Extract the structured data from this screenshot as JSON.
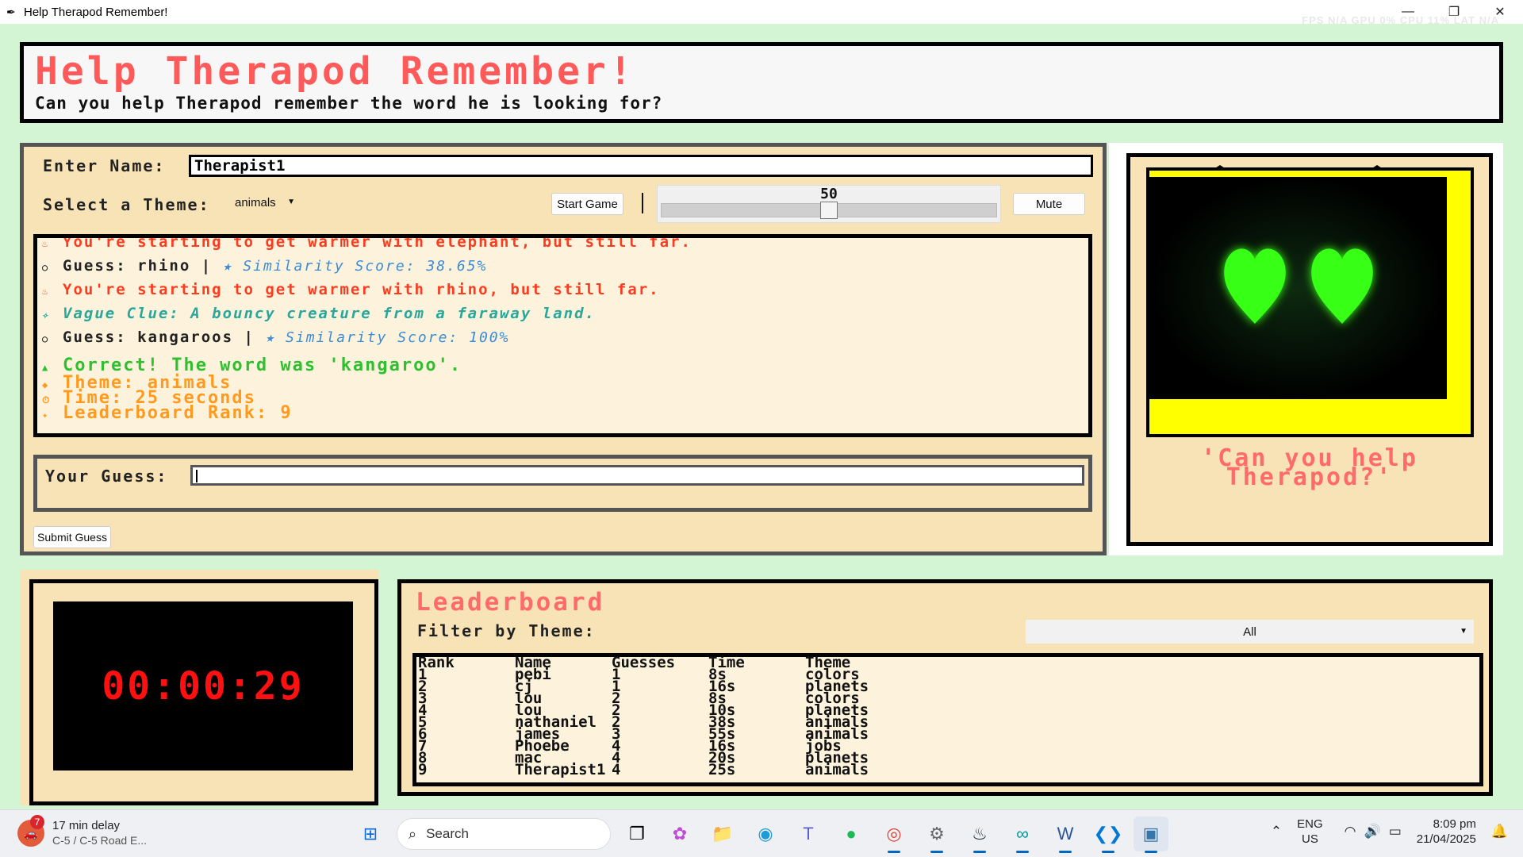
{
  "window": {
    "title": "Help Therapod Remember!",
    "overlay_stats": "FPS N/A   GPU 0%   CPU 11%   LAT N/A",
    "controls": [
      "—",
      "❐",
      "✕"
    ]
  },
  "header": {
    "title": "Help Therapod Remember!",
    "subtitle": "Can you help Therapod remember the word he is looking for?"
  },
  "form": {
    "name_label": "Enter Name:",
    "name_value": "Therapist1",
    "theme_label": "Select a Theme:",
    "theme_value": "animals",
    "start_button": "Start Game",
    "volume_value": "50",
    "volume_level": 0.5,
    "mute_button": "Mute"
  },
  "log": {
    "lines": [
      {
        "icon": "♨",
        "text": "You're starting to get warmer with elephant, but still far."
      },
      {
        "icon": "○",
        "guess_prefix": "Guess: rhino |",
        "score": "Similarity Score: 38.65%"
      },
      {
        "icon": "♨",
        "text": "You're starting to get warmer with rhino, but still far."
      },
      {
        "icon": "✧",
        "text": "Vague Clue: A bouncy creature from a faraway land."
      },
      {
        "icon": "○",
        "guess_prefix": "Guess: kangaroos |",
        "score": "Similarity Score: 100%"
      }
    ],
    "result": {
      "correct": "Correct! The word was 'kangaroo'.",
      "theme": "Theme: animals",
      "time": "Time: 25 seconds",
      "rank": "Leaderboard Rank: 9"
    }
  },
  "guess": {
    "label": "Your Guess:",
    "value": "",
    "submit_button": "Submit Guess"
  },
  "character": {
    "speech": "'Can you help Therapod?'"
  },
  "timer": {
    "value": "00:00:29"
  },
  "leaderboard": {
    "title": "Leaderboard",
    "filter_label": "Filter by Theme:",
    "filter_value": "All",
    "columns": [
      "Rank",
      "Name",
      "Guesses",
      "Time",
      "Theme"
    ],
    "rows": [
      [
        "1",
        "pebi",
        "1",
        "8s",
        "colors"
      ],
      [
        "2",
        "cj",
        "1",
        "16s",
        "planets"
      ],
      [
        "3",
        "lou",
        "2",
        "8s",
        "colors"
      ],
      [
        "4",
        "lou",
        "2",
        "10s",
        "planets"
      ],
      [
        "5",
        "nathaniel",
        "2",
        "38s",
        "animals"
      ],
      [
        "6",
        "james",
        "3",
        "55s",
        "animals"
      ],
      [
        "7",
        "Phoebe",
        "4",
        "16s",
        "jobs"
      ],
      [
        "8",
        "mac",
        "4",
        "20s",
        "planets"
      ],
      [
        "9",
        "Therapist1",
        "4",
        "25s",
        "animals"
      ]
    ]
  },
  "taskbar": {
    "weather_badge": "7",
    "weather_title": "17 min delay",
    "weather_sub": "C-5 / C-5 Road E...",
    "search_placeholder": "Search",
    "lang_top": "ENG",
    "lang_bottom": "US",
    "time": "8:09 pm",
    "date": "21/04/2025"
  },
  "colors": {
    "panel_bg": "#f7e3b5",
    "title_red": "#ff5a5a",
    "screen_yellow": "#ffff00",
    "heart_green": "#39ff14",
    "timer_red": "#ff1010"
  }
}
